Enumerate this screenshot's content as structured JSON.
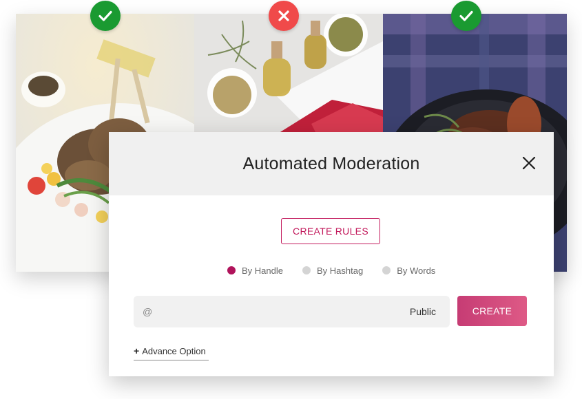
{
  "gallery": {
    "photos": [
      {
        "name": "lamb-chops-photo",
        "status": "approved",
        "status_icon": "check-icon"
      },
      {
        "name": "spices-carpaccio-photo",
        "status": "rejected",
        "status_icon": "close-icon"
      },
      {
        "name": "braised-meat-pot-photo",
        "status": "approved",
        "status_icon": "check-icon"
      }
    ]
  },
  "modal": {
    "title": "Automated Moderation",
    "close_icon": "close-icon",
    "create_rules_label": "CREATE RULES",
    "rule_types": [
      {
        "label": "By Handle",
        "selected": true
      },
      {
        "label": "By Hashtag",
        "selected": false
      },
      {
        "label": "By Words",
        "selected": false
      }
    ],
    "input": {
      "prefix": "@",
      "value": "",
      "placeholder": ""
    },
    "visibility": "Public",
    "create_label": "CREATE",
    "advance_icon": "plus-icon",
    "advance_label": "Advance Option"
  },
  "colors": {
    "accent": "#c2185b",
    "approved": "#1a9a31",
    "rejected": "#f04a4a",
    "create_gradient_start": "#c63c74",
    "create_gradient_end": "#de5a86"
  }
}
